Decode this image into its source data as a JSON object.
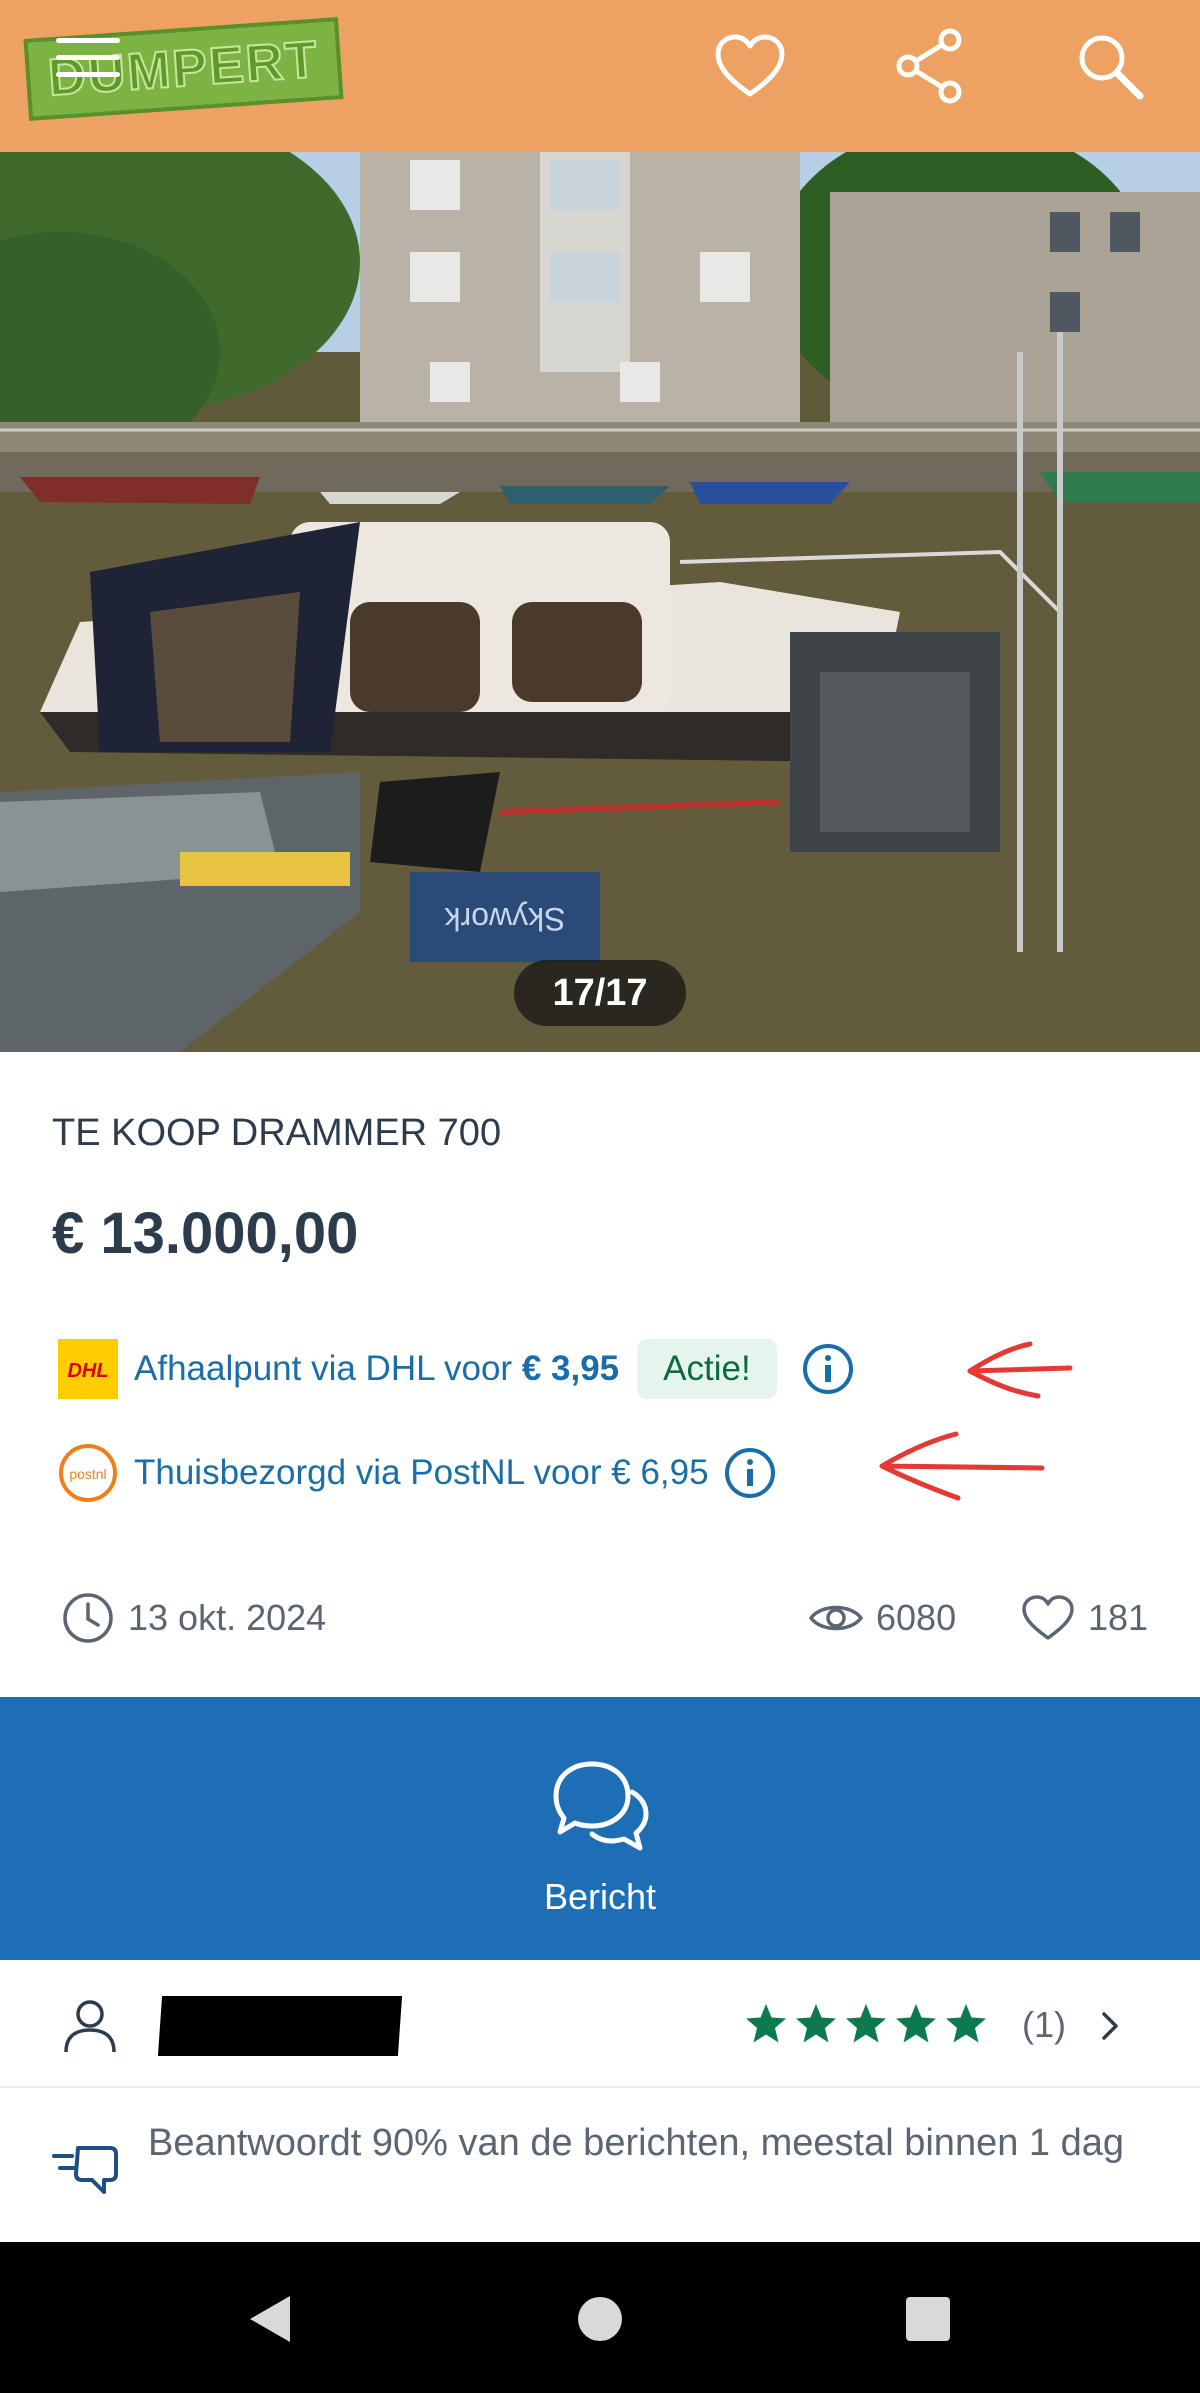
{
  "header": {
    "logo_text": "DUMPERT",
    "icons": [
      "menu-icon",
      "heart-icon",
      "share-icon",
      "search-icon"
    ],
    "background_color": "#eda162"
  },
  "gallery": {
    "counter": "17/17",
    "boat_stencil_text": "Skywork"
  },
  "listing": {
    "title": "TE KOOP DRAMMER 700",
    "price": "€ 13.000,00"
  },
  "shipping": {
    "dhl": {
      "logo_text": "DHL",
      "text_prefix": "Afhaalpunt via DHL voor",
      "price": "€ 3,95",
      "badge": "Actie!"
    },
    "postnl": {
      "logo_text": "postnl",
      "text": "Thuisbezorgd via PostNL voor € 6,95"
    },
    "annotation_color": "#e53935"
  },
  "meta": {
    "date": "13 okt. 2024",
    "views": "6080",
    "favorites": "181"
  },
  "cta": {
    "label": "Bericht",
    "background_color": "#1d6eb4"
  },
  "seller": {
    "rating_stars": 5,
    "rating_count": "(1)",
    "star_color": "#0d7a4e"
  },
  "response": {
    "text": "Beantwoordt 90% van de berichten, meestal binnen 1 dag"
  },
  "system_nav": {
    "buttons": [
      "back-icon",
      "home-icon",
      "recents-icon"
    ]
  }
}
